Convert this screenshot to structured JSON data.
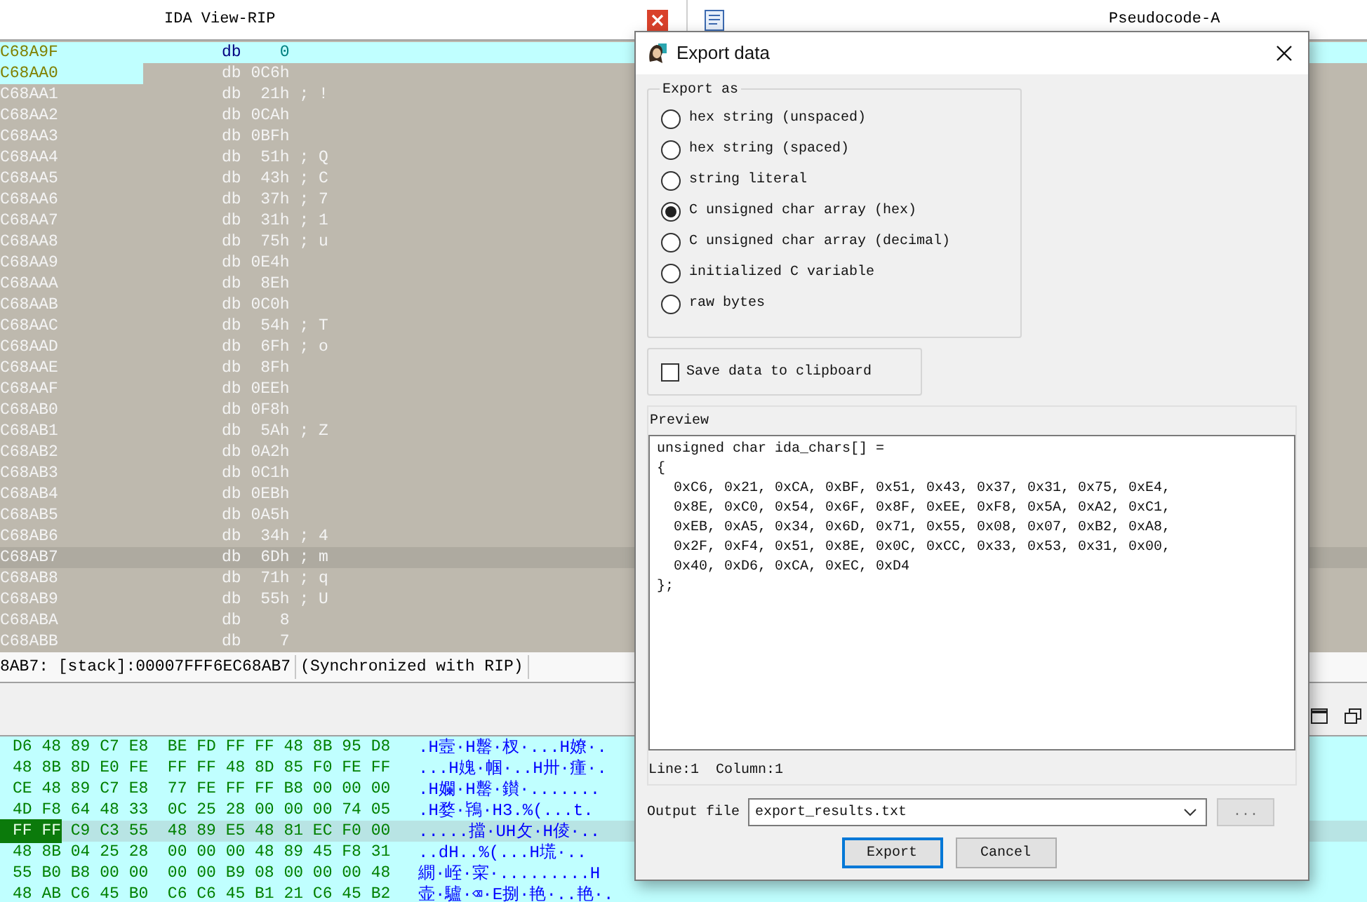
{
  "ida_view": {
    "title": "IDA View-RIP",
    "rows": [
      {
        "address": "C68A9F",
        "mnemonic": "db",
        "operand": "0",
        "comment": "",
        "kind": "highlighted"
      },
      {
        "address": "C68AA0",
        "mnemonic": "db",
        "operand": "0C6h",
        "comment": "",
        "kind": "address-highlighted"
      },
      {
        "address": "C68AA1",
        "mnemonic": "db",
        "operand": "21h",
        "comment": "; !",
        "kind": "plain"
      },
      {
        "address": "C68AA2",
        "mnemonic": "db",
        "operand": "0CAh",
        "comment": "",
        "kind": "plain"
      },
      {
        "address": "C68AA3",
        "mnemonic": "db",
        "operand": "0BFh",
        "comment": "",
        "kind": "plain"
      },
      {
        "address": "C68AA4",
        "mnemonic": "db",
        "operand": "51h",
        "comment": "; Q",
        "kind": "plain"
      },
      {
        "address": "C68AA5",
        "mnemonic": "db",
        "operand": "43h",
        "comment": "; C",
        "kind": "plain"
      },
      {
        "address": "C68AA6",
        "mnemonic": "db",
        "operand": "37h",
        "comment": "; 7",
        "kind": "plain"
      },
      {
        "address": "C68AA7",
        "mnemonic": "db",
        "operand": "31h",
        "comment": "; 1",
        "kind": "plain"
      },
      {
        "address": "C68AA8",
        "mnemonic": "db",
        "operand": "75h",
        "comment": "; u",
        "kind": "plain"
      },
      {
        "address": "C68AA9",
        "mnemonic": "db",
        "operand": "0E4h",
        "comment": "",
        "kind": "plain"
      },
      {
        "address": "C68AAA",
        "mnemonic": "db",
        "operand": "8Eh",
        "comment": "",
        "kind": "plain"
      },
      {
        "address": "C68AAB",
        "mnemonic": "db",
        "operand": "0C0h",
        "comment": "",
        "kind": "plain"
      },
      {
        "address": "C68AAC",
        "mnemonic": "db",
        "operand": "54h",
        "comment": "; T",
        "kind": "plain"
      },
      {
        "address": "C68AAD",
        "mnemonic": "db",
        "operand": "6Fh",
        "comment": "; o",
        "kind": "plain"
      },
      {
        "address": "C68AAE",
        "mnemonic": "db",
        "operand": "8Fh",
        "comment": "",
        "kind": "plain"
      },
      {
        "address": "C68AAF",
        "mnemonic": "db",
        "operand": "0EEh",
        "comment": "",
        "kind": "plain"
      },
      {
        "address": "C68AB0",
        "mnemonic": "db",
        "operand": "0F8h",
        "comment": "",
        "kind": "plain"
      },
      {
        "address": "C68AB1",
        "mnemonic": "db",
        "operand": "5Ah",
        "comment": "; Z",
        "kind": "plain"
      },
      {
        "address": "C68AB2",
        "mnemonic": "db",
        "operand": "0A2h",
        "comment": "",
        "kind": "plain"
      },
      {
        "address": "C68AB3",
        "mnemonic": "db",
        "operand": "0C1h",
        "comment": "",
        "kind": "plain"
      },
      {
        "address": "C68AB4",
        "mnemonic": "db",
        "operand": "0EBh",
        "comment": "",
        "kind": "plain"
      },
      {
        "address": "C68AB5",
        "mnemonic": "db",
        "operand": "0A5h",
        "comment": "",
        "kind": "plain"
      },
      {
        "address": "C68AB6",
        "mnemonic": "db",
        "operand": "34h",
        "comment": "; 4",
        "kind": "plain"
      },
      {
        "address": "C68AB7",
        "mnemonic": "db",
        "operand": "6Dh",
        "comment": "; m",
        "kind": "current"
      },
      {
        "address": "C68AB8",
        "mnemonic": "db",
        "operand": "71h",
        "comment": "; q",
        "kind": "plain"
      },
      {
        "address": "C68AB9",
        "mnemonic": "db",
        "operand": "55h",
        "comment": "; U",
        "kind": "plain"
      },
      {
        "address": "C68ABA",
        "mnemonic": "db",
        "operand": "8",
        "comment": "",
        "kind": "plain"
      },
      {
        "address": "C68ABB",
        "mnemonic": "db",
        "operand": "7",
        "comment": "",
        "kind": "plain"
      }
    ]
  },
  "pseudocode_tab": {
    "title": "Pseudocode-A"
  },
  "status_line": {
    "location": "8AB7: [stack]:00007FFF6EC68AB7",
    "sync": "(Synchronized with RIP)"
  },
  "hex_view": {
    "rows": [
      {
        "highlight_bytes": "",
        "bytes": "D6 48 89 C7 E8  BE FD FF FF 48 8B 95 D8",
        "ascii": ".H壼·H罊·杈·...H嫽·.",
        "current": false
      },
      {
        "highlight_bytes": "",
        "bytes": "48 8B 8D E0 FE  FF FF 48 8D 85 F0 FE FF",
        "ascii": "...H媿·帼·..H卅·瘇·.",
        "current": false
      },
      {
        "highlight_bytes": "",
        "bytes": "CE 48 89 C7 E8  77 FE FF FF B8 00 00 00",
        "ascii": ".H孄·H罊·鑚·.......",
        "current": false
      },
      {
        "highlight_bytes": "",
        "bytes": "4D F8 64 48 33  0C 25 28 00 00 00 74 05",
        "ascii": ".H婺·鴇·H3.%(...t.",
        "current": false
      },
      {
        "highlight_bytes": "FF FF",
        "bytes": "C9 C3 55  48 89 E5 48 81 EC F0 00",
        "ascii": ".....擋·UH攵·H倰·..",
        "current": true
      },
      {
        "highlight_bytes": "",
        "bytes": "48 8B 04 25 28  00 00 00 48 89 45 F8 31",
        "ascii": "..dH..%(...H塃·..",
        "current": false
      },
      {
        "highlight_bytes": "",
        "bytes": "55 B0 B8 00 00  00 00 B9 08 00 00 00 48",
        "ascii": "繝·峌·寀·.........H",
        "current": false
      },
      {
        "highlight_bytes": "",
        "bytes": "48 AB C6 45 B0  C6 C6 45 B1 21 C6 45 B2",
        "ascii": "壶·驢·⌫·E捌·艳·..艳·.",
        "current": false
      }
    ]
  },
  "dialog": {
    "title": "Export data",
    "export_as": {
      "label": "Export as",
      "options": [
        {
          "label": "hex string (unspaced)",
          "selected": false
        },
        {
          "label": "hex string (spaced)",
          "selected": false
        },
        {
          "label": "string literal",
          "selected": false
        },
        {
          "label": "C unsigned char array (hex)",
          "selected": true
        },
        {
          "label": "C unsigned char array (decimal)",
          "selected": false
        },
        {
          "label": "initialized C variable",
          "selected": false
        },
        {
          "label": "raw bytes",
          "selected": false
        }
      ]
    },
    "save_to_clipboard": {
      "label": "Save data to clipboard",
      "checked": false
    },
    "preview": {
      "label": "Preview",
      "lines": [
        "unsigned char ida_chars[] =",
        "{",
        "  0xC6, 0x21, 0xCA, 0xBF, 0x51, 0x43, 0x37, 0x31, 0x75, 0xE4,",
        "  0x8E, 0xC0, 0x54, 0x6F, 0x8F, 0xEE, 0xF8, 0x5A, 0xA2, 0xC1,",
        "  0xEB, 0xA5, 0x34, 0x6D, 0x71, 0x55, 0x08, 0x07, 0xB2, 0xA8,",
        "  0x2F, 0xF4, 0x51, 0x8E, 0x0C, 0xCC, 0x33, 0x53, 0x31, 0x00,",
        "  0x40, 0xD6, 0xCA, 0xEC, 0xD4",
        "};"
      ]
    },
    "position": "Line:1  Column:1",
    "output_file": {
      "label": "Output file",
      "value": "export_results.txt"
    },
    "browse_button": "...",
    "buttons": [
      {
        "label": "Export",
        "kind": "default"
      },
      {
        "label": "Cancel",
        "kind": "normal"
      }
    ]
  }
}
